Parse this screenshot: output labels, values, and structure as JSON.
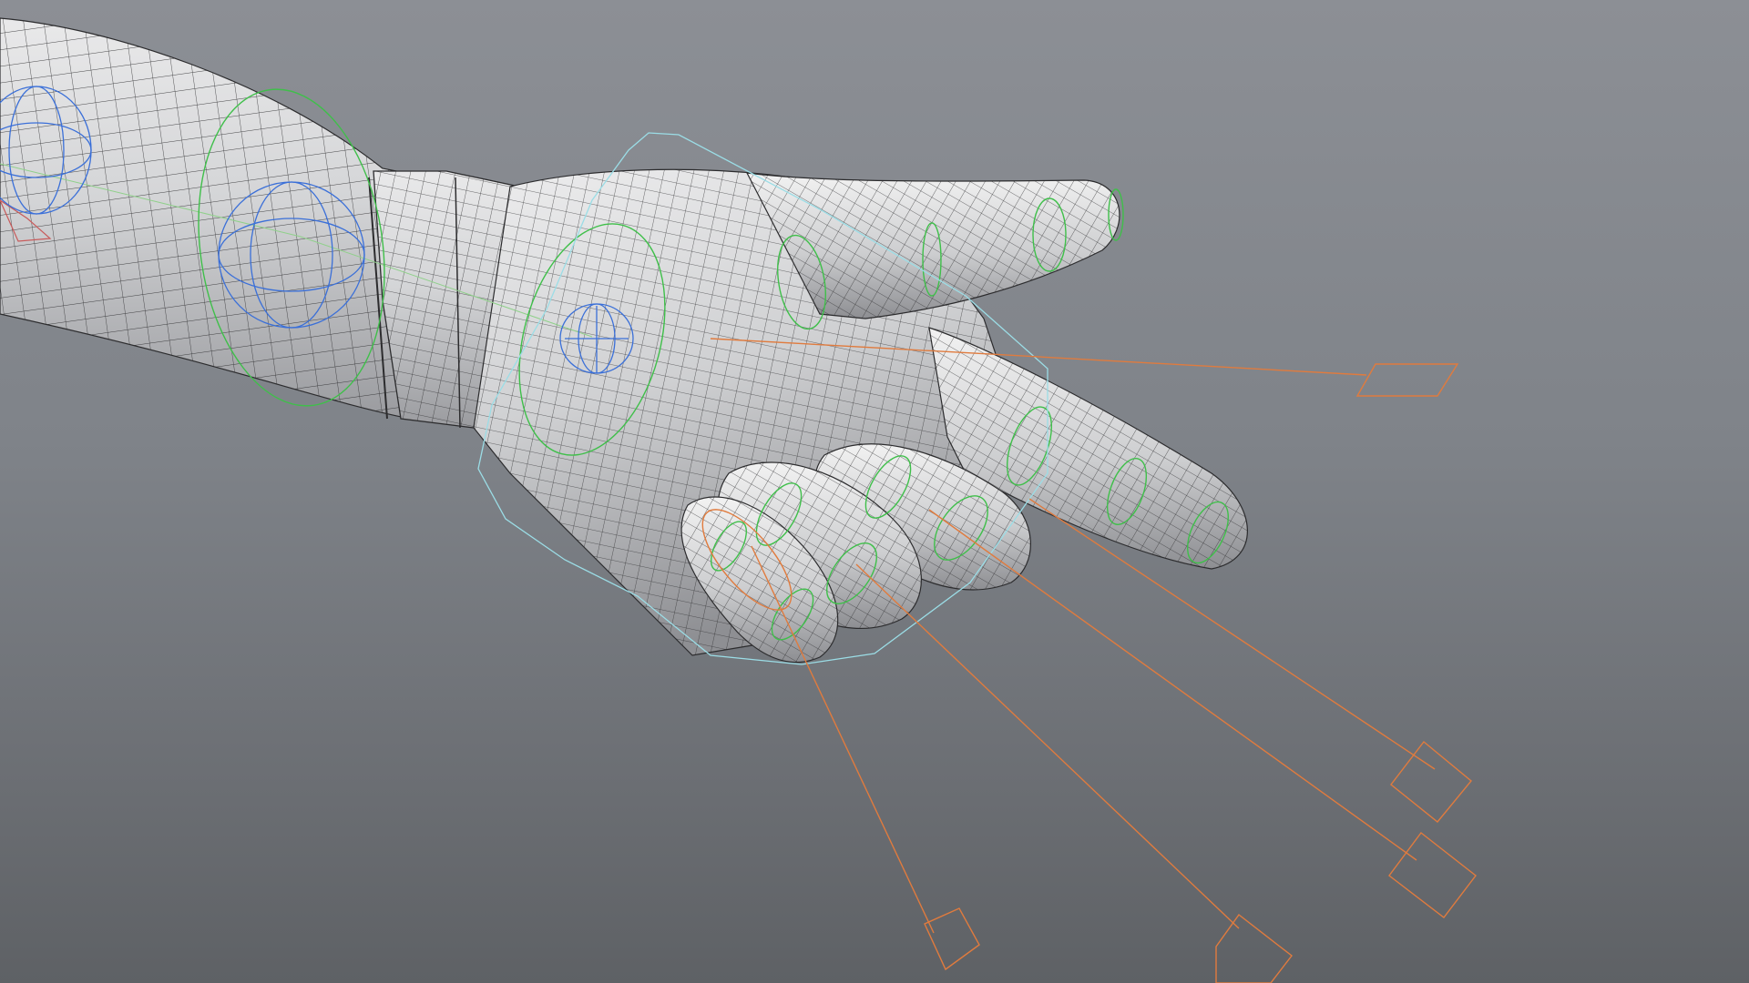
{
  "viewport": {
    "background_top": "#8c8f95",
    "background_bottom": "#5e6165"
  },
  "scene": {
    "mesh": {
      "fill": "#c9cacd",
      "highlight": "#f0f0f0",
      "shadow": "#8f9094",
      "wire_color": "#2c2c2e"
    },
    "rig_colors": {
      "fk_control": "#3fbf4a",
      "joint": "#3a6fd8",
      "hand_control": "#9bdde6",
      "ik_control": "#e07b3e",
      "bone_line": "#b25b5b"
    }
  }
}
